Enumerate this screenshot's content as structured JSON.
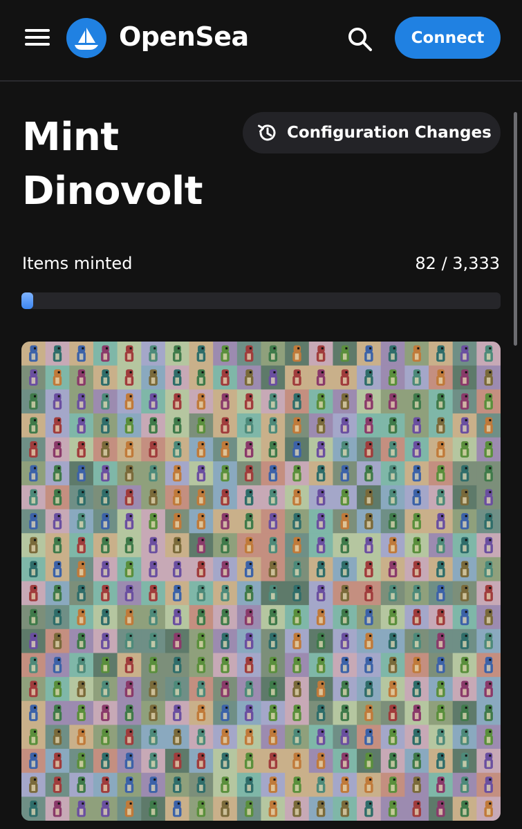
{
  "header": {
    "brand_name": "OpenSea",
    "connect_label": "Connect",
    "brand_color": "#2081e2",
    "icons": [
      "menu-icon",
      "opensea-logo-icon",
      "search-icon"
    ]
  },
  "main": {
    "title": "Mint Dinovolt",
    "config_button_label": "Configuration Changes",
    "config_icon": "history-icon",
    "progress": {
      "label": "Items minted",
      "count_text": "82 / 3,333",
      "minted": 82,
      "total": 3333
    },
    "mosaic": {
      "description_icon": "nft-collection-mosaic",
      "palette": [
        "#7fb7a8",
        "#c7a9b6",
        "#8fa07c",
        "#a4a7c9",
        "#7c8f7a",
        "#c9b08a",
        "#6f8f86",
        "#b5c6a0",
        "#9c8bb0",
        "#8aa9bf",
        "#c48f80",
        "#5e7a6a"
      ]
    }
  }
}
